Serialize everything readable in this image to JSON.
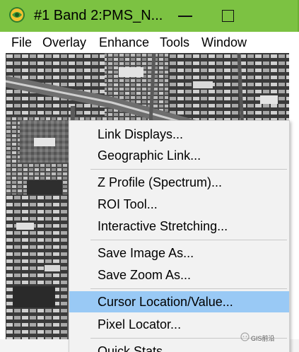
{
  "window": {
    "title": "#1 Band 2:PMS_N...",
    "titlebar_color": "#7cc242"
  },
  "menubar": {
    "items": [
      {
        "label": "File"
      },
      {
        "label": "Overlay"
      },
      {
        "label": "Enhance"
      },
      {
        "label": "Tools"
      },
      {
        "label": "Window"
      }
    ]
  },
  "image": {
    "description_icon": "grayscale-satellite-image"
  },
  "context_menu": {
    "groups": [
      [
        "Link Displays...",
        "Geographic Link..."
      ],
      [
        "Z Profile (Spectrum)...",
        "ROI Tool...",
        "Interactive Stretching..."
      ],
      [
        "Save Image As...",
        "Save Zoom As..."
      ],
      [
        "Cursor Location/Value...",
        "Pixel Locator...",
        "Quick Stats"
      ]
    ],
    "highlighted": "Cursor Location/Value...",
    "highlight_color": "#99c9f5"
  },
  "watermark": {
    "text": "GIS前沿"
  }
}
